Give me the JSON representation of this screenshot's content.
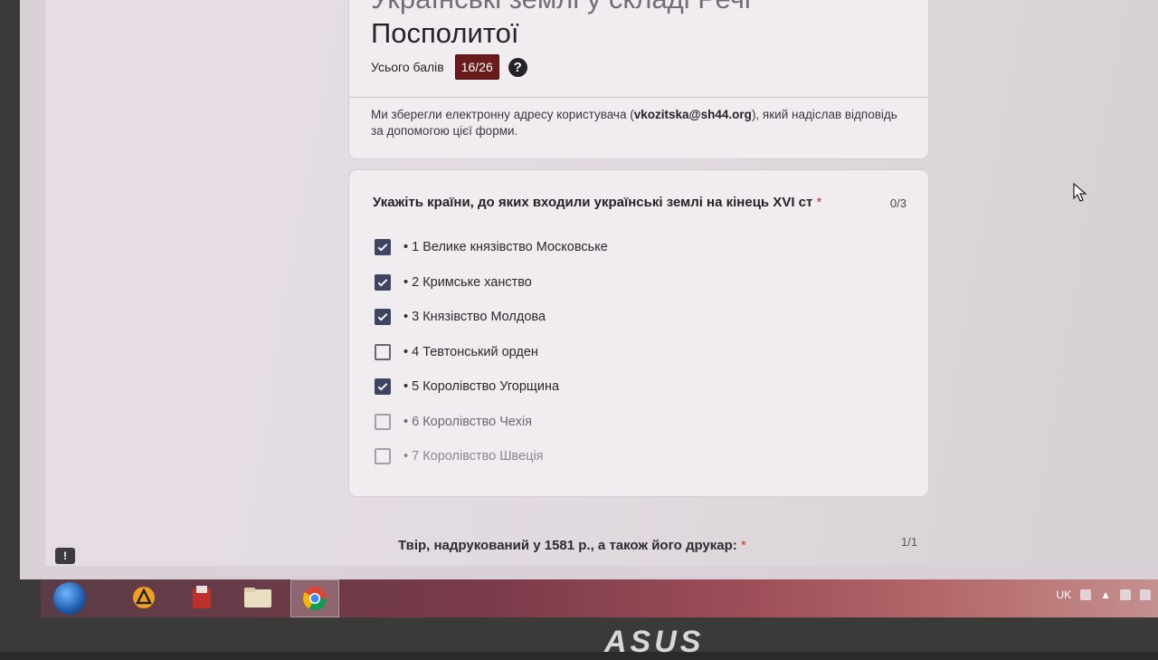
{
  "form": {
    "title_line1": "Українські землі у складі Речі",
    "title_line2": "Посполитої",
    "score_label": "Усього балів",
    "score_value": "16/26",
    "help_icon": "?",
    "info_prefix": "Ми зберегли електронну адресу користувача (",
    "email": "vkozitska@sh44.org",
    "info_suffix": "), який надіслав відповідь за допомогою цієї форми."
  },
  "question1": {
    "title": "Укажіть країни, до яких входили українські землі на кінець XVI ст",
    "required_mark": "*",
    "points": "0/3",
    "options": [
      {
        "label": "• 1 Велике князівство Московське",
        "checked": true
      },
      {
        "label": "• 2 Кримське ханство",
        "checked": true
      },
      {
        "label": "• 3 Князівство Молдова",
        "checked": true
      },
      {
        "label": "• 4 Тевтонський орден",
        "checked": false
      },
      {
        "label": "• 5 Королівство Угорщина",
        "checked": true
      },
      {
        "label": "• 6 Королівство Чехія",
        "checked": false
      },
      {
        "label": "• 7 Королівство Швеція",
        "checked": false
      }
    ]
  },
  "question2": {
    "title": "Твір, надрукований у 1581 р., а також його друкар:",
    "required_mark": "*",
    "points": "1/1"
  },
  "feedback_icon": "!",
  "taskbar": {
    "icons": [
      "windows-start-icon",
      "avast-icon",
      "file-manager-icon",
      "explorer-icon",
      "chrome-icon"
    ],
    "language": "UK"
  },
  "brand": "ASUS",
  "colors": {
    "accent": "#3e4560",
    "score_badge": "#6a1c1c",
    "required": "#c0392b"
  }
}
